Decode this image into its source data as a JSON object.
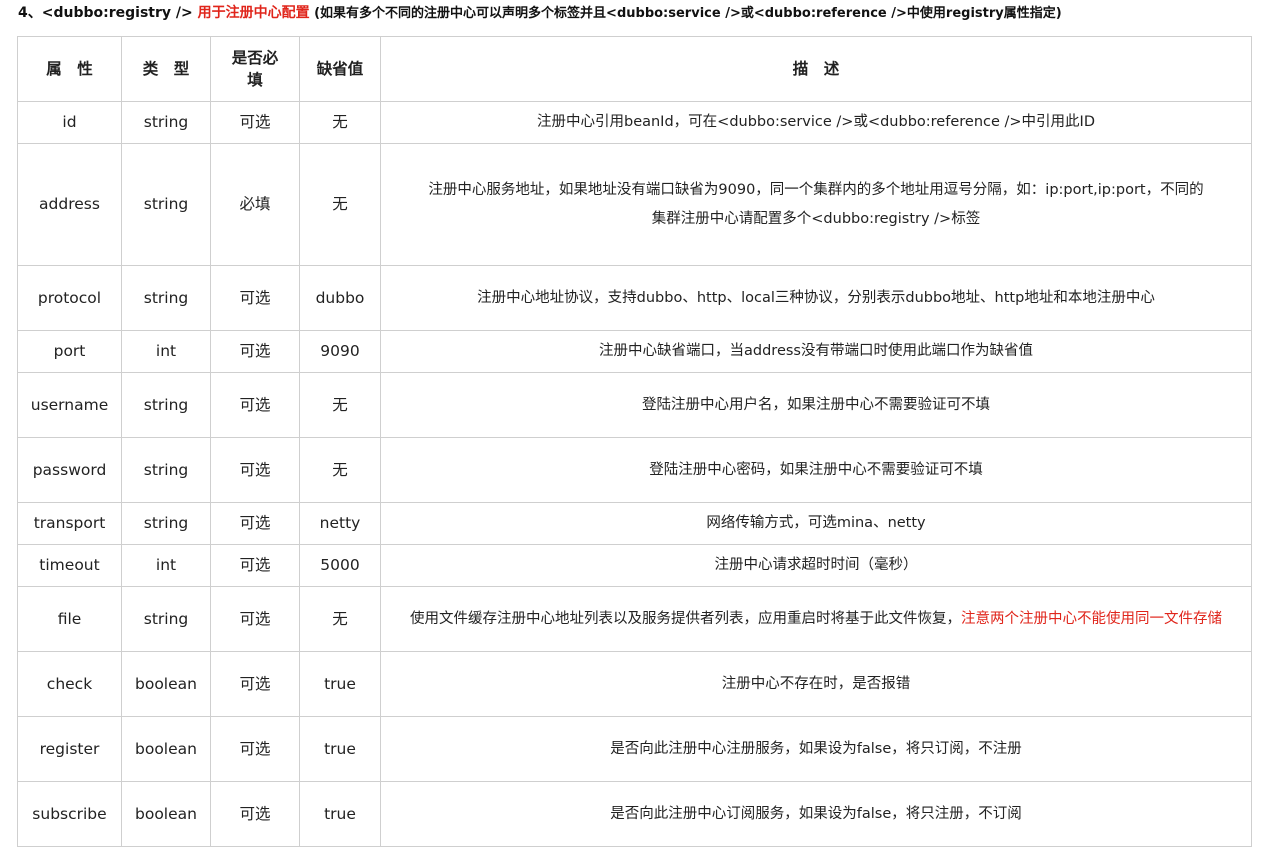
{
  "heading": {
    "prefix": "4、<dubbo:registry /> ",
    "highlight": "用于注册中心配置",
    "note": " (如果有多个不同的注册中心可以声明多个标签并且<dubbo:service />或<dubbo:reference />中使用registry属性指定)"
  },
  "table": {
    "headers": {
      "name": "属　性",
      "type": "类　型",
      "required": "是否必填",
      "default": "缺省值",
      "description": "描　述"
    },
    "rows": [
      {
        "name": "id",
        "type": "string",
        "required": "可选",
        "default": "无",
        "description": "注册中心引用beanId，可在<dubbo:service />或<dubbo:reference />中引用此ID"
      },
      {
        "name": "address",
        "type": "string",
        "required": "必填",
        "default": "无",
        "description": "注册中心服务地址，如果地址没有端口缺省为9090，同一个集群内的多个地址用逗号分隔，如：ip:port,ip:port，不同的",
        "description_2": "集群注册中心请配置多个<dubbo:registry />标签"
      },
      {
        "name": "protocol",
        "type": "string",
        "required": "可选",
        "default": "dubbo",
        "description": "注册中心地址协议，支持dubbo、http、local三种协议，分别表示dubbo地址、http地址和本地注册中心"
      },
      {
        "name": "port",
        "type": "int",
        "required": "可选",
        "default": "9090",
        "description": "注册中心缺省端口，当address没有带端口时使用此端口作为缺省值"
      },
      {
        "name": "username",
        "type": "string",
        "required": "可选",
        "default": "无",
        "description": "登陆注册中心用户名，如果注册中心不需要验证可不填"
      },
      {
        "name": "password",
        "type": "string",
        "required": "可选",
        "default": "无",
        "description": "登陆注册中心密码，如果注册中心不需要验证可不填"
      },
      {
        "name": "transport",
        "type": "string",
        "required": "可选",
        "default": "netty",
        "description": "网络传输方式，可选mina、netty"
      },
      {
        "name": "timeout",
        "type": "int",
        "required": "可选",
        "default": "5000",
        "description": "注册中心请求超时时间（毫秒）"
      },
      {
        "name": "file",
        "type": "string",
        "required": "可选",
        "default": "无",
        "description": "使用文件缓存注册中心地址列表以及服务提供者列表，应用重启时将基于此文件恢复，",
        "description_warning": "注意两个注册中心不能使用同一文件存储"
      },
      {
        "name": "check",
        "type": "boolean",
        "required": "可选",
        "default": "true",
        "description": "注册中心不存在时，是否报错"
      },
      {
        "name": "register",
        "type": "boolean",
        "required": "可选",
        "default": "true",
        "description": "是否向此注册中心注册服务，如果设为false，将只订阅，不注册"
      },
      {
        "name": "subscribe",
        "type": "boolean",
        "required": "可选",
        "default": "true",
        "description": "是否向此注册中心订阅服务，如果设为false，将只注册，不订阅"
      }
    ]
  }
}
